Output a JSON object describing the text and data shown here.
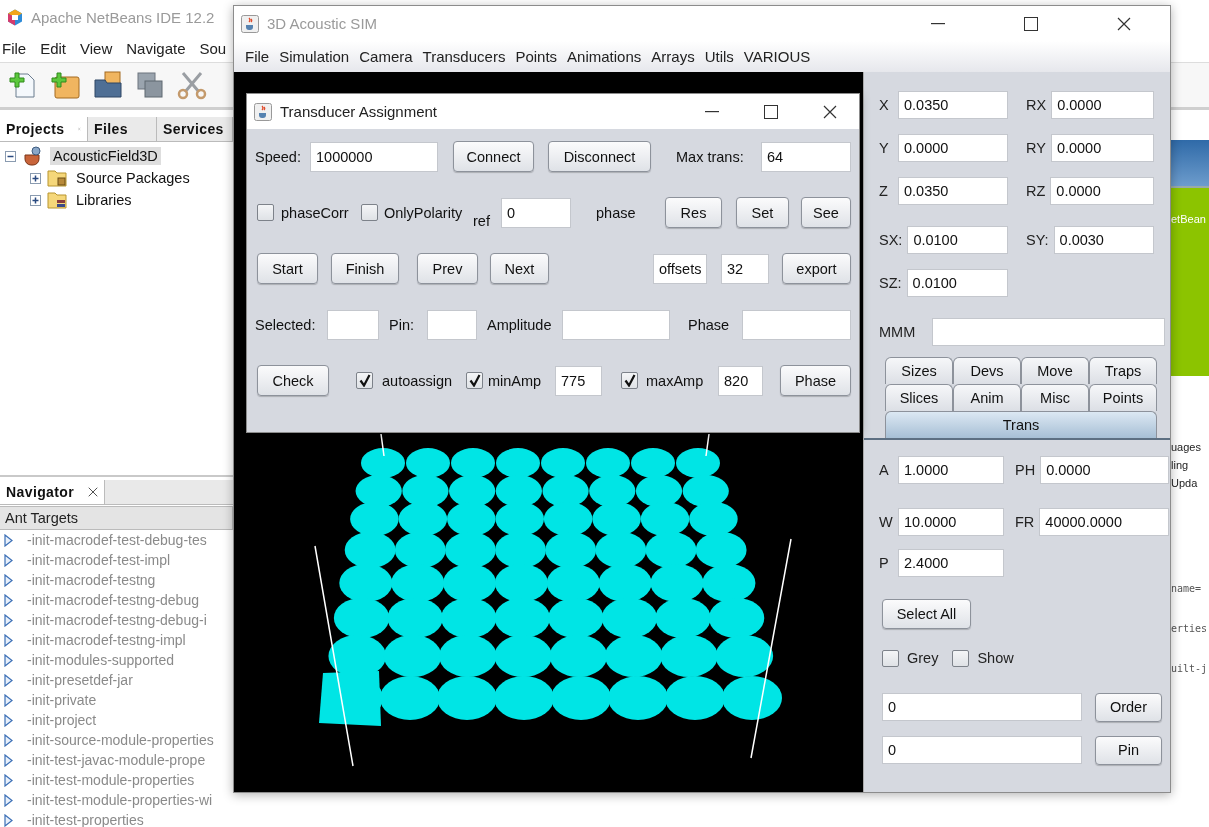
{
  "ide": {
    "title": "Apache NetBeans IDE 12.2",
    "menu": [
      "File",
      "Edit",
      "View",
      "Navigate",
      "Sou"
    ],
    "panel_tabs": [
      {
        "label": "Projects",
        "selected": true,
        "closable": true
      },
      {
        "label": "Files",
        "selected": false,
        "closable": false
      },
      {
        "label": "Services",
        "selected": false,
        "closable": false
      }
    ],
    "tree": [
      {
        "label": "AcousticField3D",
        "kind": "project",
        "expanded": true,
        "selected": true,
        "children": [
          {
            "label": "Source Packages",
            "kind": "package",
            "expanded": false,
            "selected": false
          },
          {
            "label": "Libraries",
            "kind": "library",
            "expanded": false,
            "selected": false
          }
        ]
      }
    ],
    "navigator": {
      "title": "Navigator",
      "filter": "Ant Targets",
      "targets": [
        "-init-macrodef-test-debug-tes",
        "-init-macrodef-test-impl",
        "-init-macrodef-testng",
        "-init-macrodef-testng-debug",
        "-init-macrodef-testng-debug-i",
        "-init-macrodef-testng-impl",
        "-init-modules-supported",
        "-init-presetdef-jar",
        "-init-private",
        "-init-project",
        "-init-source-module-properties",
        "-init-test-javac-module-prope",
        "-init-test-module-properties",
        "-init-test-module-properties-wi",
        "-init-test-properties"
      ]
    },
    "background_texts": [
      {
        "kind": "banner",
        "text": "etBean"
      },
      {
        "kind": "text",
        "text": "uages"
      },
      {
        "kind": "text",
        "text": "ling"
      },
      {
        "kind": "text",
        "text": "Upda"
      },
      {
        "kind": "code",
        "text": "name="
      },
      {
        "kind": "code",
        "text": "erties"
      },
      {
        "kind": "code",
        "text": "uilt-j"
      }
    ]
  },
  "sim": {
    "title": "3D Acoustic SIM",
    "menu": [
      "File",
      "Simulation",
      "Camera",
      "Transducers",
      "Points",
      "Animations",
      "Arrays",
      "Utils",
      "VARIOUS"
    ],
    "panel": {
      "position_rows": [
        [
          {
            "label": "X",
            "value": "0.0350"
          },
          {
            "label": "RX",
            "value": "0.0000"
          }
        ],
        [
          {
            "label": "Y",
            "value": "0.0000"
          },
          {
            "label": "RY",
            "value": "0.0000"
          }
        ],
        [
          {
            "label": "Z",
            "value": "0.0350"
          },
          {
            "label": "RZ",
            "value": "0.0000"
          }
        ],
        [
          {
            "label": "SX:",
            "value": "0.0100"
          },
          {
            "label": "SY:",
            "value": "0.0030"
          }
        ],
        [
          {
            "label": "SZ:",
            "value": "0.0100"
          }
        ]
      ],
      "mmm": {
        "label": "MMM"
      },
      "tabs": [
        [
          {
            "label": "Sizes",
            "selected": false
          },
          {
            "label": "Devs",
            "selected": false
          },
          {
            "label": "Move",
            "selected": false
          },
          {
            "label": "Traps",
            "selected": false
          }
        ],
        [
          {
            "label": "Slices",
            "selected": false
          },
          {
            "label": "Anim",
            "selected": false
          },
          {
            "label": "Misc",
            "selected": false
          },
          {
            "label": "Points",
            "selected": false
          }
        ],
        [
          {
            "label": "Trans",
            "selected": true
          }
        ]
      ],
      "trans_rows": [
        [
          {
            "label": "A",
            "value": "1.0000"
          },
          {
            "label": "PH",
            "value": "0.0000"
          }
        ],
        [
          {
            "label": "W",
            "value": "10.0000"
          },
          {
            "label": "FR",
            "value": "40000.0000"
          }
        ],
        [
          {
            "label": "P",
            "value": "2.4000"
          }
        ]
      ],
      "select_all": "Select All",
      "options": [
        {
          "label": "Grey",
          "checked": false
        },
        {
          "label": "Show",
          "checked": false
        }
      ],
      "number_rows": [
        {
          "value": "0",
          "button": "Order"
        },
        {
          "value": "0",
          "button": "Pin"
        }
      ]
    }
  },
  "dialog": {
    "title": "Transducer Assignment",
    "form_lines": [
      [
        {
          "kind": "label",
          "text": "Speed:"
        },
        {
          "kind": "field",
          "value": "1000000"
        },
        {
          "kind": "button",
          "text": "Connect"
        },
        {
          "kind": "button",
          "text": "Disconnect"
        },
        {
          "kind": "label",
          "text": "Max trans:"
        },
        {
          "kind": "field",
          "value": "64"
        }
      ],
      [
        {
          "kind": "check",
          "checked": false
        },
        {
          "kind": "label",
          "text": "phaseCorr"
        },
        {
          "kind": "check",
          "checked": false
        },
        {
          "kind": "label",
          "text": "OnlyPolarity"
        },
        {
          "kind": "label",
          "text": "ref"
        },
        {
          "kind": "field",
          "value": "0"
        },
        {
          "kind": "label",
          "text": "phase"
        },
        {
          "kind": "button",
          "text": "Res"
        },
        {
          "kind": "button",
          "text": "Set"
        },
        {
          "kind": "button",
          "text": "See"
        }
      ],
      [
        {
          "kind": "button",
          "text": "Start"
        },
        {
          "kind": "button",
          "text": "Finish"
        },
        {
          "kind": "button",
          "text": "Prev"
        },
        {
          "kind": "button",
          "text": "Next"
        },
        {
          "kind": "field",
          "value": "offsets"
        },
        {
          "kind": "field",
          "value": "32"
        },
        {
          "kind": "button",
          "text": "export"
        }
      ],
      [
        {
          "kind": "label",
          "text": "Selected:"
        },
        {
          "kind": "field"
        },
        {
          "kind": "label",
          "text": "Pin:"
        },
        {
          "kind": "field"
        },
        {
          "kind": "label",
          "text": "Amplitude"
        },
        {
          "kind": "field"
        },
        {
          "kind": "label",
          "text": "Phase"
        },
        {
          "kind": "field"
        }
      ],
      [
        {
          "kind": "button",
          "text": "Check"
        },
        {
          "kind": "check",
          "checked": true
        },
        {
          "kind": "label",
          "text": "autoassign"
        },
        {
          "kind": "check",
          "checked": true
        },
        {
          "kind": "label",
          "text": "minAmp"
        },
        {
          "kind": "field",
          "value": "775"
        },
        {
          "kind": "check",
          "checked": true
        },
        {
          "kind": "label",
          "text": "maxAmp"
        },
        {
          "kind": "field",
          "value": "820"
        },
        {
          "kind": "button",
          "text": "Phase"
        }
      ]
    ]
  }
}
